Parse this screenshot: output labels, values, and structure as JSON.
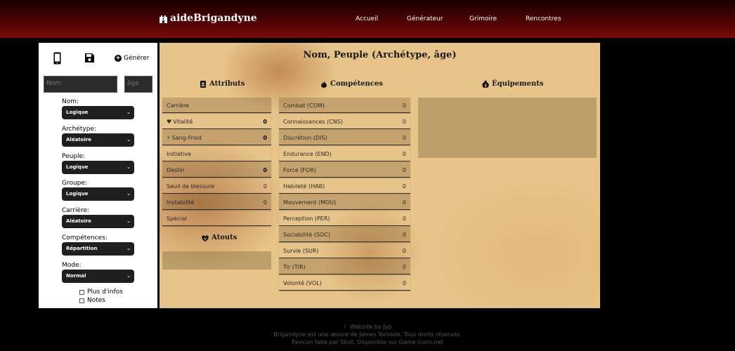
{
  "header": {
    "brand": "aideBrigandyne",
    "nav": [
      {
        "label": "Accueil"
      },
      {
        "label": "Générateur"
      },
      {
        "label": "Grimoire"
      },
      {
        "label": "Rencontres"
      }
    ]
  },
  "sidebar": {
    "generate_label": "Générer",
    "name_placeholder": "Nom",
    "age_placeholder": "âge",
    "fields": [
      {
        "label": "Nom:",
        "value": "Logique"
      },
      {
        "label": "Archétype:",
        "value": "Aléatoire"
      },
      {
        "label": "Peuple:",
        "value": "Logique"
      },
      {
        "label": "Groupe:",
        "value": "Logique"
      },
      {
        "label": "Carrière:",
        "value": "Aléatoire"
      },
      {
        "label": "Compétences:",
        "value": "Répartition"
      },
      {
        "label": "Mode:",
        "value": "Normal"
      }
    ],
    "checkboxes": [
      {
        "label": "Plus d'infos"
      },
      {
        "label": "Notes"
      }
    ]
  },
  "sheet": {
    "title": "Nom, Peuple (Archétype, âge)",
    "attributs_title": "Attributs",
    "atouts_title": "Atouts",
    "competences_title": "Compétences",
    "equipements_title": "Équipements",
    "attributs": [
      {
        "label": "Carrière",
        "value": ""
      },
      {
        "label": "Vitalité",
        "value": "0",
        "icon": "heart-icon"
      },
      {
        "label": "Sang-Froid",
        "value": "0",
        "icon": "bolt-icon"
      },
      {
        "label": "Initiative",
        "value": ""
      },
      {
        "label": "Destin",
        "value": "0"
      },
      {
        "label": "Seuil de blessure",
        "value": "0"
      },
      {
        "label": "Instabilité",
        "value": "0"
      },
      {
        "label": "Spécial",
        "value": ""
      }
    ],
    "competences": [
      {
        "label": "Combat (COM)",
        "value": "0"
      },
      {
        "label": "Connaissances (CNS)",
        "value": "0"
      },
      {
        "label": "Discrétion (DIS)",
        "value": "0"
      },
      {
        "label": "Endurance (END)",
        "value": "0"
      },
      {
        "label": "Force (FOR)",
        "value": "0"
      },
      {
        "label": "Habileté (HAB)",
        "value": "0"
      },
      {
        "label": "Mouvement (MOU)",
        "value": "0"
      },
      {
        "label": "Perception (PER)",
        "value": "0"
      },
      {
        "label": "Sociabilité (SOC)",
        "value": "0"
      },
      {
        "label": "Survie (SUR)",
        "value": "0"
      },
      {
        "label": "Tir (TIR)",
        "value": "0"
      },
      {
        "label": "Volonté (VOL)",
        "value": "0"
      }
    ]
  },
  "footer": {
    "line1": "Website by Jyp",
    "line2": "Brigandyne est une œuvre de James Tornade. Tous droits réservés.",
    "line3": "Favicon faite par Skoll. Disponible sur Game-icons.net"
  },
  "colors": {
    "header_red": "#7a0909",
    "parchment": "#e7c48a",
    "select_bg": "#1f1f1f"
  }
}
